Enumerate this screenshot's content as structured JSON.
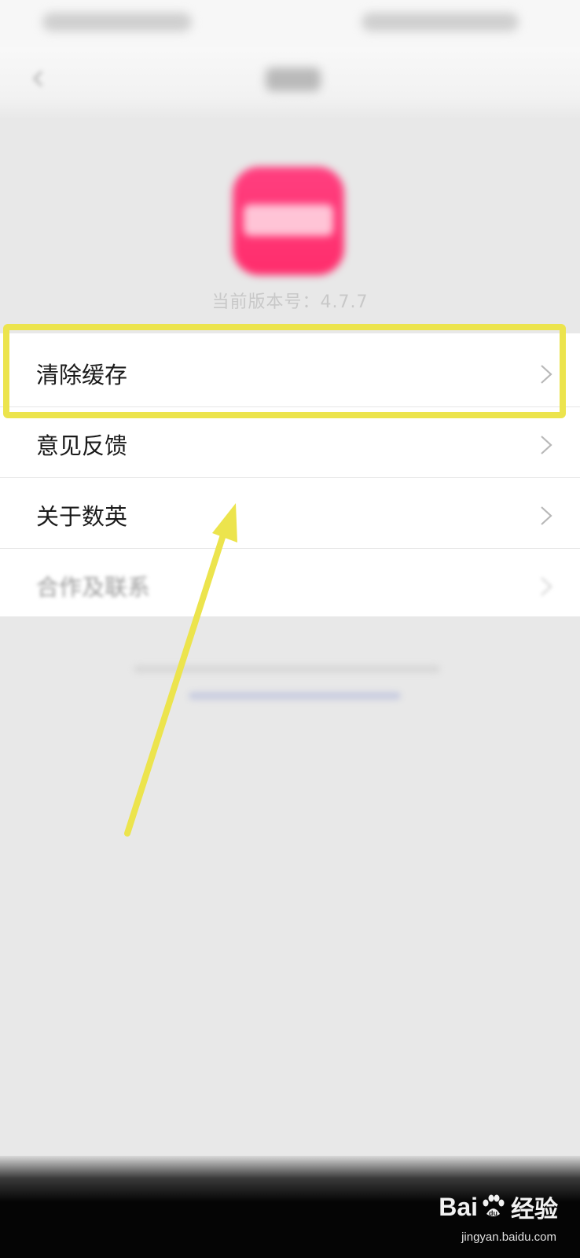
{
  "app": {
    "version_text": "当前版本号：4.7.7"
  },
  "colors": {
    "logo": "#ff3a78",
    "highlight": "#ece44d",
    "background": "#e8e8e8"
  },
  "menu": {
    "items": [
      {
        "label": "清除缓存",
        "icon": "chevron-right-icon"
      },
      {
        "label": "意见反馈",
        "icon": "chevron-right-icon"
      },
      {
        "label": "关于数英",
        "icon": "chevron-right-icon"
      },
      {
        "label": "合作及联系",
        "icon": "chevron-right-icon"
      }
    ]
  },
  "watermark": {
    "brand": "Bai",
    "brand_tail": "du",
    "product": "经验",
    "site": "jingyan.baidu.com"
  }
}
